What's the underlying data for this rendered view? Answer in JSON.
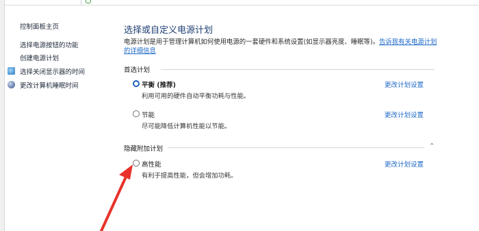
{
  "sidebar": {
    "home": "控制面板主页",
    "items": [
      {
        "label": "选择电源按钮的功能",
        "icon": ""
      },
      {
        "label": "创建电源计划",
        "icon": ""
      },
      {
        "label": "选择关闭显示器的时间",
        "icon": "monitor-icon"
      },
      {
        "label": "更改计算机睡眠时间",
        "icon": "moon-icon"
      }
    ]
  },
  "main": {
    "title": "选择或自定义电源计划",
    "description": "电源计划是用于管理计算机如何使用电源的一套硬件和系统设置(如显示器亮度、睡眠等)。",
    "description_link": "告诉我有关电源计划的详细信息",
    "preferred_section": "首选计划",
    "hidden_section": "隐藏附加计划",
    "change_link": "更改计划设置",
    "plans": [
      {
        "name": "平衡 (推荐)",
        "desc": "利用可用的硬件自动平衡功耗与性能。",
        "selected": true
      },
      {
        "name": "节能",
        "desc": "尽可能降低计算机性能以节能。",
        "selected": false
      },
      {
        "name": "高性能",
        "desc": "有利于提高性能，但会增加功耗。",
        "selected": false
      }
    ]
  },
  "colors": {
    "link": "#1e69c8",
    "title": "#1d3f73",
    "arrow": "#e8322a"
  }
}
